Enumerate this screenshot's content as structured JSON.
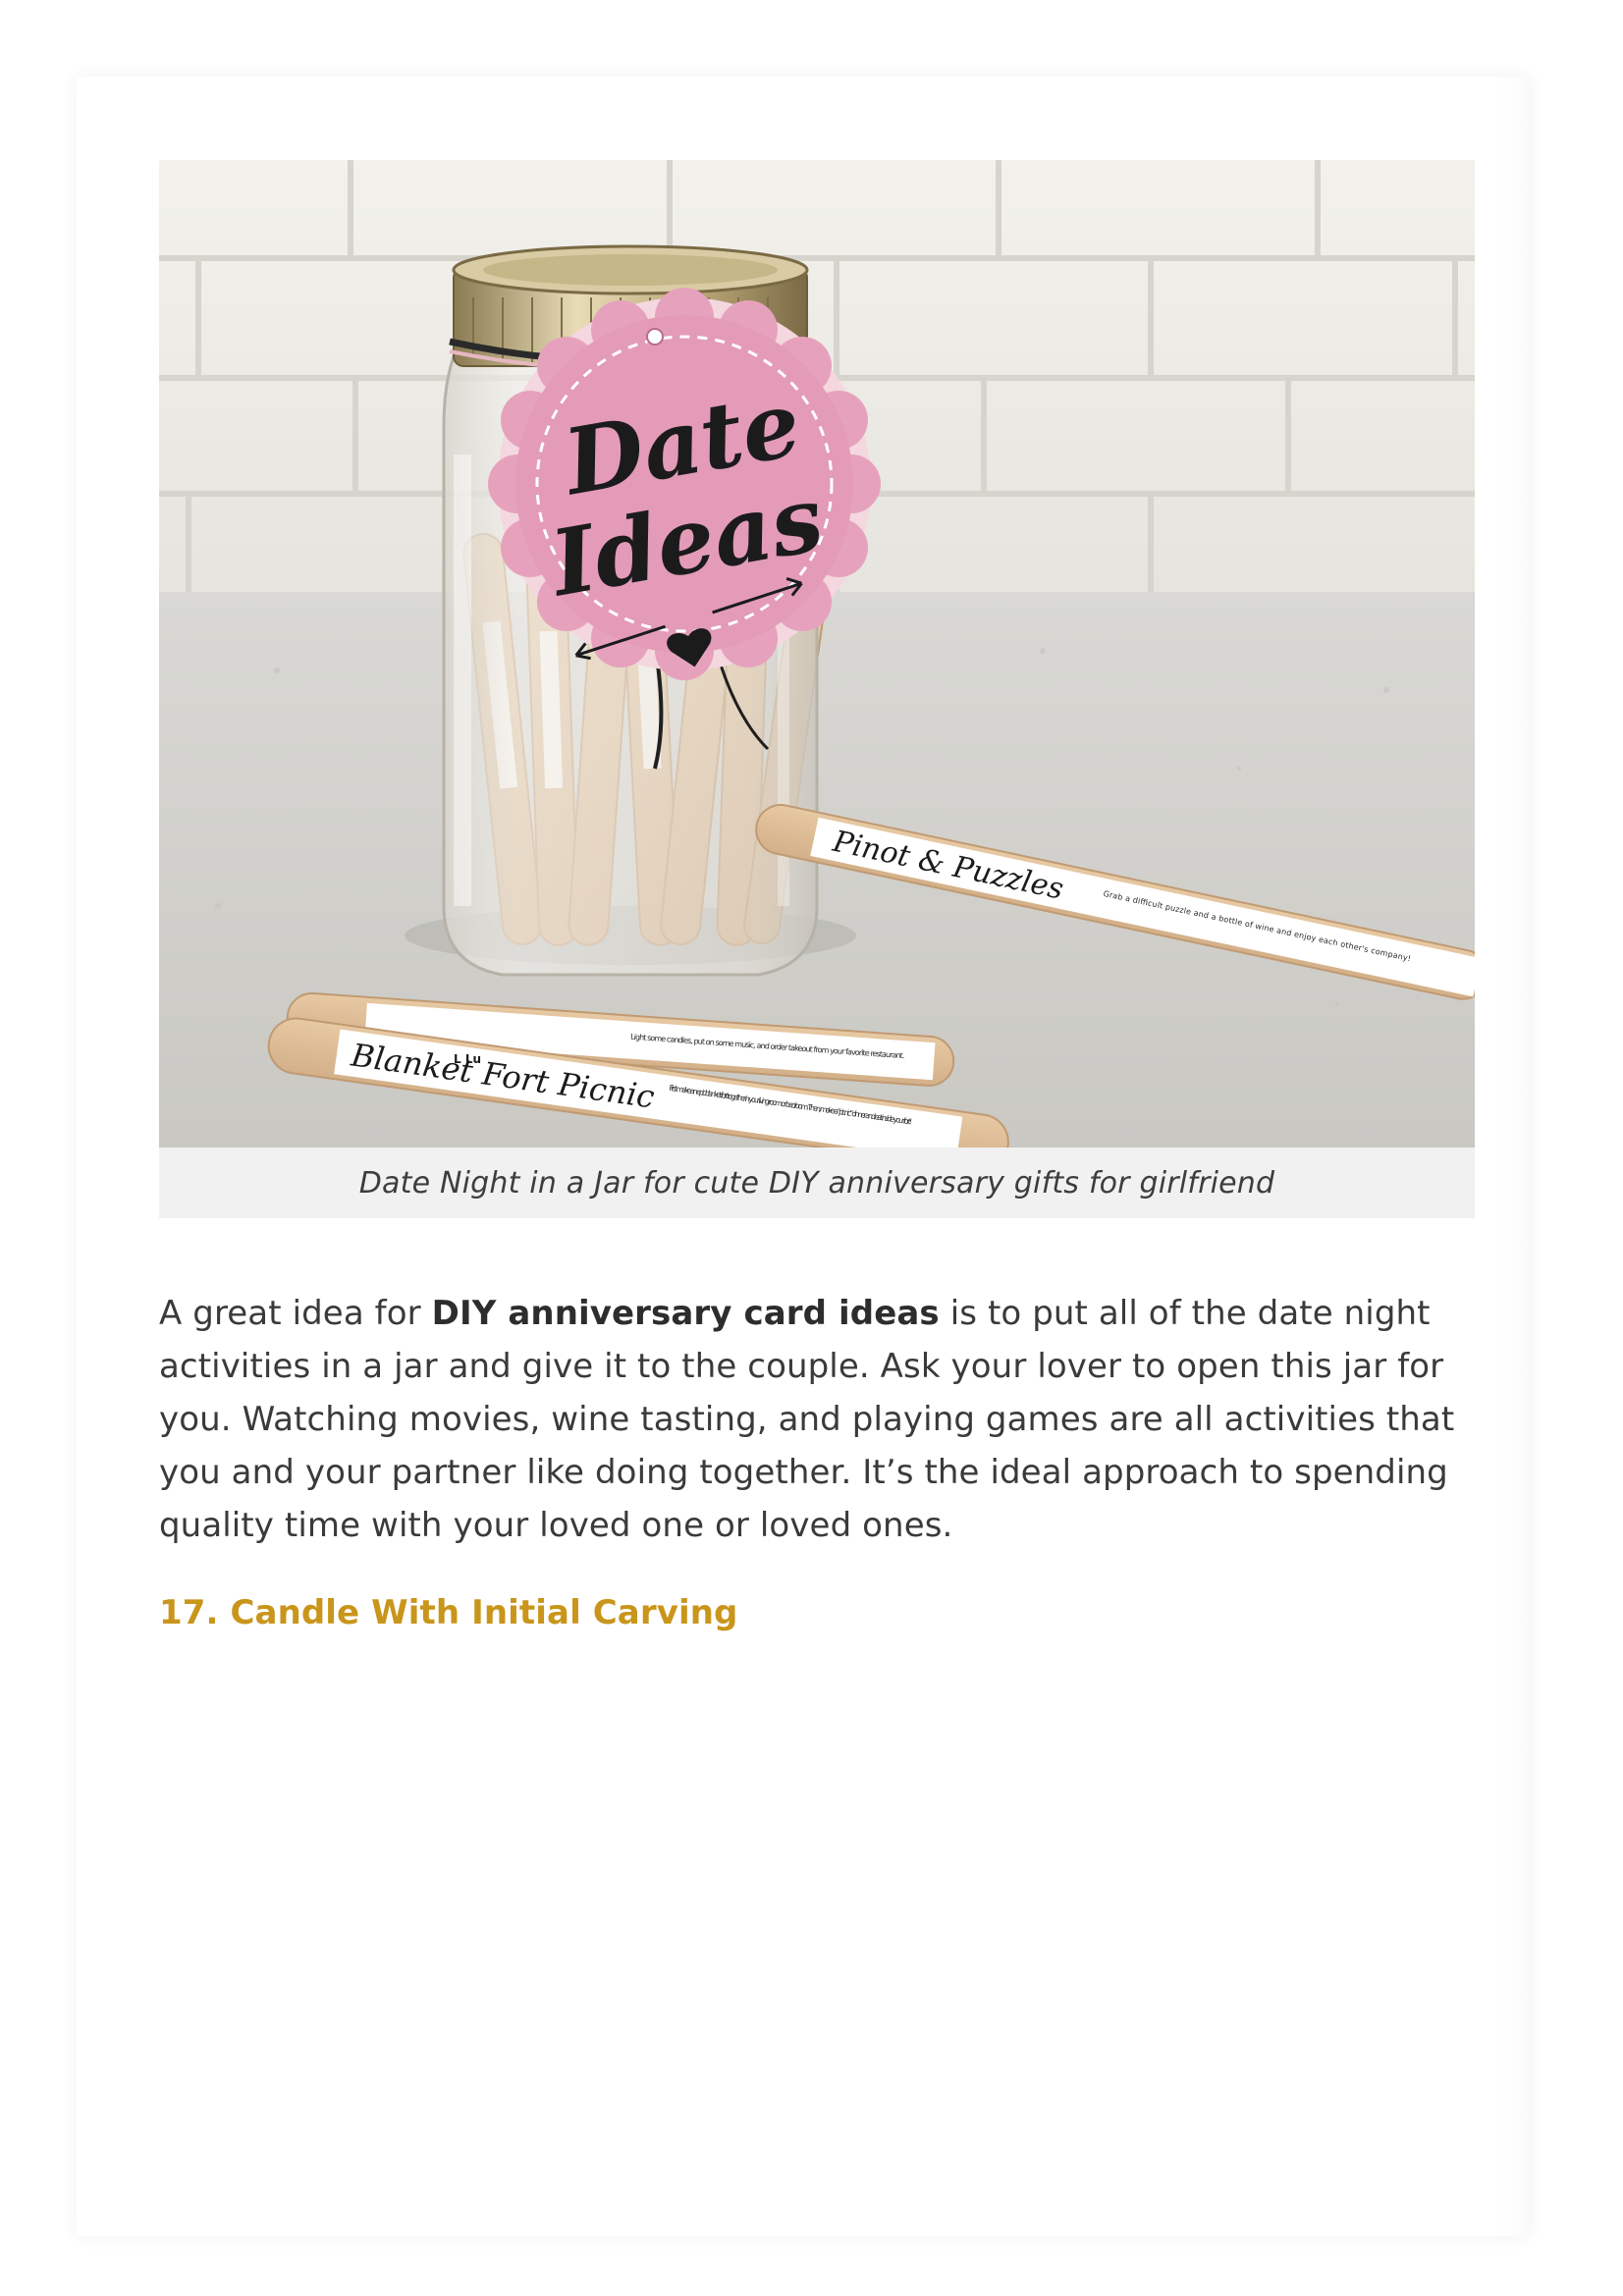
{
  "figure": {
    "image_alt": "Mason jar of popsicle sticks with a pink tag",
    "tag_line1": "Date",
    "tag_line2": "Ideas",
    "stick_left_title": "Blanket Fort Picnic",
    "stick_right_title": "Pinot & Puzzles",
    "stick_left_small": "L Lu",
    "stick_note_top": "Light some candles, put on some music, and order takeout from your favorite restaurant.",
    "stick_note_bottom": "First make an epic blanket fort together in your living room or bedroom. Then, make a \"picnic\" dinner and eat inside your fort!",
    "stick_note_right": "Grab a difficult puzzle and a bottle of wine and enjoy each other's company!",
    "caption": "Date Night in a Jar for cute DIY anniversary gifts for girlfriend"
  },
  "article": {
    "paragraph_prefix": "A great idea for ",
    "paragraph_strong": "DIY anniversary card ideas",
    "paragraph_suffix": " is to put all of the date night activities in a jar and give it to the couple. Ask your lover to open this jar for you. Watching movies, wine tasting, and playing games are all activities that you and your partner like doing together. It’s the ideal approach to spending quality time with your loved one or loved ones.",
    "section_heading": "17. Candle With Initial Carving"
  },
  "colors": {
    "heading_accent": "#c9951a",
    "caption_bg": "#f1f1f1",
    "tag_pink": "#e39bb8"
  }
}
